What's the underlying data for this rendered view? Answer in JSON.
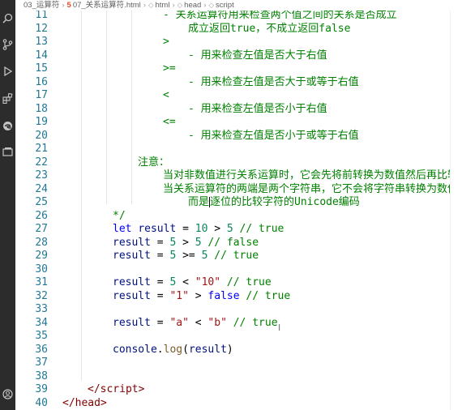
{
  "breadcrumb": {
    "folder": "03_运算符",
    "file": "07_关系运算符.html",
    "items": [
      "html",
      "head",
      "script"
    ]
  },
  "activity_icons": [
    "search-icon",
    "source-control-icon",
    "run-debug-icon",
    "extensions-icon",
    "edge-devtools-icon",
    "remote-explorer-icon",
    "account-icon"
  ],
  "lines": [
    {
      "n": "11",
      "indent": 4,
      "tokens": [
        {
          "t": "- 关系运算符用来检查两个值之间的关系是否成立",
          "c": "c-comment"
        }
      ]
    },
    {
      "n": "12",
      "indent": 5,
      "tokens": [
        {
          "t": "成立返回true，不成立返回false",
          "c": "c-comment"
        }
      ]
    },
    {
      "n": "13",
      "indent": 4,
      "tokens": [
        {
          "t": ">",
          "c": "c-comment"
        }
      ]
    },
    {
      "n": "14",
      "indent": 5,
      "tokens": [
        {
          "t": "- 用来检查左值是否大于右值",
          "c": "c-comment"
        }
      ]
    },
    {
      "n": "15",
      "indent": 4,
      "tokens": [
        {
          "t": ">=",
          "c": "c-comment"
        }
      ]
    },
    {
      "n": "16",
      "indent": 5,
      "tokens": [
        {
          "t": "- 用来检查左值是否大于或等于右值",
          "c": "c-comment"
        }
      ]
    },
    {
      "n": "17",
      "indent": 4,
      "tokens": [
        {
          "t": "<",
          "c": "c-comment"
        }
      ]
    },
    {
      "n": "18",
      "indent": 5,
      "tokens": [
        {
          "t": "- 用来检查左值是否小于右值",
          "c": "c-comment"
        }
      ]
    },
    {
      "n": "19",
      "indent": 4,
      "tokens": [
        {
          "t": "<=",
          "c": "c-comment"
        }
      ]
    },
    {
      "n": "20",
      "indent": 5,
      "tokens": [
        {
          "t": "- 用来检查左值是否小于或等于右值",
          "c": "c-comment"
        }
      ]
    },
    {
      "n": "21",
      "indent": 0,
      "tokens": []
    },
    {
      "n": "22",
      "indent": 3,
      "tokens": [
        {
          "t": "注意：",
          "c": "c-comment"
        }
      ]
    },
    {
      "n": "23",
      "indent": 4,
      "tokens": [
        {
          "t": "当对非数值进行关系运算时，它会先将前转换为数值然后再比较",
          "c": "c-comment"
        }
      ]
    },
    {
      "n": "24",
      "indent": 4,
      "tokens": [
        {
          "t": "当关系运算符的两端是两个字符串，它不会将字符串转换为数值，",
          "c": "c-comment"
        }
      ]
    },
    {
      "n": "25",
      "indent": 5,
      "cursor": true,
      "tokens": [
        {
          "t": "而是",
          "c": "c-comment"
        },
        {
          "t": "逐位的比较字符的Unicode编码",
          "c": "c-comment"
        }
      ]
    },
    {
      "n": "26",
      "indent": 2,
      "tokens": [
        {
          "t": "*/",
          "c": "c-comment"
        }
      ]
    },
    {
      "n": "27",
      "indent": 2,
      "tokens": [
        {
          "t": "let",
          "c": "c-kw"
        },
        {
          "t": " ",
          "c": "c-op"
        },
        {
          "t": "result",
          "c": "c-var"
        },
        {
          "t": " = ",
          "c": "c-op"
        },
        {
          "t": "10",
          "c": "c-num"
        },
        {
          "t": " > ",
          "c": "c-op"
        },
        {
          "t": "5",
          "c": "c-num"
        },
        {
          "t": " // true",
          "c": "c-comment"
        }
      ]
    },
    {
      "n": "28",
      "indent": 2,
      "tokens": [
        {
          "t": "result",
          "c": "c-var"
        },
        {
          "t": " = ",
          "c": "c-op"
        },
        {
          "t": "5",
          "c": "c-num"
        },
        {
          "t": " > ",
          "c": "c-op"
        },
        {
          "t": "5",
          "c": "c-num"
        },
        {
          "t": " // false",
          "c": "c-comment"
        }
      ]
    },
    {
      "n": "29",
      "indent": 2,
      "tokens": [
        {
          "t": "result",
          "c": "c-var"
        },
        {
          "t": " = ",
          "c": "c-op"
        },
        {
          "t": "5",
          "c": "c-num"
        },
        {
          "t": " >= ",
          "c": "c-op"
        },
        {
          "t": "5",
          "c": "c-num"
        },
        {
          "t": " // true",
          "c": "c-comment"
        }
      ]
    },
    {
      "n": "30",
      "indent": 0,
      "tokens": []
    },
    {
      "n": "31",
      "indent": 2,
      "tokens": [
        {
          "t": "result",
          "c": "c-var"
        },
        {
          "t": " = ",
          "c": "c-op"
        },
        {
          "t": "5",
          "c": "c-num"
        },
        {
          "t": " < ",
          "c": "c-op"
        },
        {
          "t": "\"10\"",
          "c": "c-str"
        },
        {
          "t": " // true",
          "c": "c-comment"
        }
      ]
    },
    {
      "n": "32",
      "indent": 2,
      "tokens": [
        {
          "t": "result",
          "c": "c-var"
        },
        {
          "t": " = ",
          "c": "c-op"
        },
        {
          "t": "\"1\"",
          "c": "c-str"
        },
        {
          "t": " > ",
          "c": "c-op"
        },
        {
          "t": "false",
          "c": "c-kw"
        },
        {
          "t": " // true",
          "c": "c-comment"
        }
      ]
    },
    {
      "n": "33",
      "indent": 0,
      "tokens": []
    },
    {
      "n": "34",
      "indent": 2,
      "tokens": [
        {
          "t": "result",
          "c": "c-var"
        },
        {
          "t": " = ",
          "c": "c-op"
        },
        {
          "t": "\"a\"",
          "c": "c-str"
        },
        {
          "t": " < ",
          "c": "c-op"
        },
        {
          "t": "\"b\"",
          "c": "c-str"
        },
        {
          "t": " // true",
          "c": "c-comment"
        }
      ]
    },
    {
      "n": "35",
      "indent": 0,
      "tokens": []
    },
    {
      "n": "36",
      "indent": 2,
      "tokens": [
        {
          "t": "console",
          "c": "c-var"
        },
        {
          "t": ".",
          "c": "c-op"
        },
        {
          "t": "log",
          "c": "c-fn"
        },
        {
          "t": "(",
          "c": "c-op"
        },
        {
          "t": "result",
          "c": "c-var"
        },
        {
          "t": ")",
          "c": "c-op"
        }
      ]
    },
    {
      "n": "37",
      "indent": 0,
      "tokens": []
    },
    {
      "n": "38",
      "indent": 0,
      "tokens": []
    },
    {
      "n": "39",
      "indent": 1,
      "tokens": [
        {
          "t": "</",
          "c": "c-tag"
        },
        {
          "t": "script",
          "c": "c-tag"
        },
        {
          "t": ">",
          "c": "c-tag"
        }
      ]
    },
    {
      "n": "40",
      "indent": 0,
      "tokens": [
        {
          "t": "</",
          "c": "c-tag"
        },
        {
          "t": "head",
          "c": "c-tag"
        },
        {
          "t": ">",
          "c": "c-tag"
        }
      ]
    }
  ]
}
